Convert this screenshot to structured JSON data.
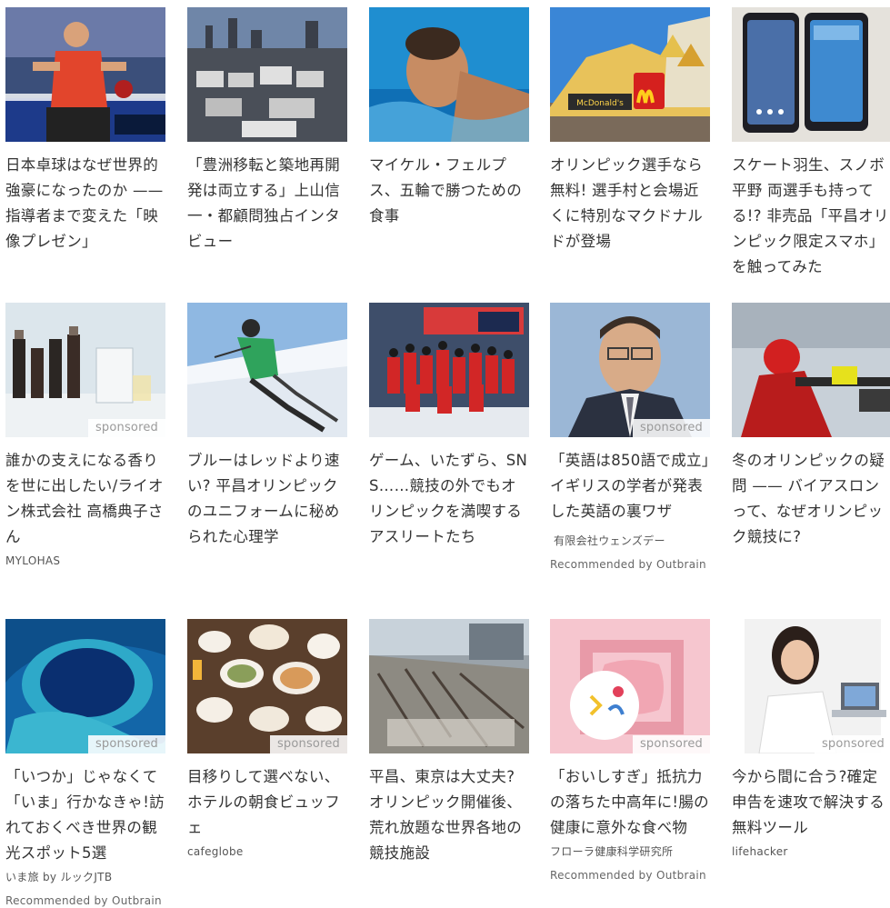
{
  "colors": {
    "text": "#333333",
    "sponsored": "#9a9a9a",
    "source": "#555555"
  },
  "cards": [
    {
      "title": "日本卓球はなぜ世界的強豪になったのか —— 指導者まで変えた「映像プレゼン」",
      "image": "table-tennis-player"
    },
    {
      "title": "「豊洲移転と築地再開発は両立する」上山信一・都顧問独占インタビュー",
      "image": "tsukiji-market-aerial"
    },
    {
      "title": "マイケル・フェルプス、五輪で勝つための食事",
      "image": "swimmer"
    },
    {
      "title": "オリンピック選手なら無料! 選手村と会場近くに特別なマクドナルドが登場",
      "image": "mcdonalds-pavilion",
      "logo_text": "McDonald's"
    },
    {
      "title": "スケート羽生、スノボ平野 両選手も持ってる!? 非売品「平昌オリンピック限定スマホ」を触ってみた",
      "image": "smartphones"
    },
    {
      "title": "誰かの支えになる香りを世に出したい/ライオン株式会社 高橋典子さん",
      "image": "perfume-bottles",
      "sponsored": "sponsored",
      "source": "MYLOHAS"
    },
    {
      "title": "ブルーはレッドより速い? 平昌オリンピックのユニフォームに秘められた心理学",
      "image": "skier"
    },
    {
      "title": "ゲーム、いたずら、SNS……競技の外でもオリンピックを満喫するアスリートたち",
      "image": "team-photo"
    },
    {
      "title": "「英語は850語で成立」イギリスの学者が発表した英語の裏ワザ",
      "image": "businessman-portrait",
      "sponsored": "sponsored",
      "source": "有限会社ウェンズデー",
      "recommended": "Recommended by Outbrain"
    },
    {
      "title": "冬のオリンピックの疑問 —— バイアスロンって、なぜオリンピック競技に?",
      "image": "biathlete"
    },
    {
      "title": "「いつか」じゃなくて「いま」行かなきゃ!訪れておくべき世界の観光スポット5選",
      "image": "blue-hole",
      "sponsored": "sponsored",
      "source": "いま旅 by ルックJTB",
      "recommended": "Recommended by Outbrain"
    },
    {
      "title": "目移りして選べない、ホテルの朝食ビュッフェ",
      "image": "breakfast-buffet",
      "sponsored": "sponsored",
      "source": "cafeglobe"
    },
    {
      "title": "平昌、東京は大丈夫? オリンピック開催後、荒れ放題な世界各地の競技施設",
      "image": "abandoned-venue"
    },
    {
      "title": "「おいしすぎ」抵抗力の落ちた中高年に!腸の健康に意外な食べ物",
      "image": "intestine-illustration",
      "sponsored": "sponsored",
      "source": "フローラ健康科学研究所",
      "recommended": "Recommended by Outbrain"
    },
    {
      "title": "今から間に合う?確定申告を速攻で解決する無料ツール",
      "image": "woman-laptop",
      "sponsored": "sponsored",
      "source": "lifehacker"
    }
  ]
}
